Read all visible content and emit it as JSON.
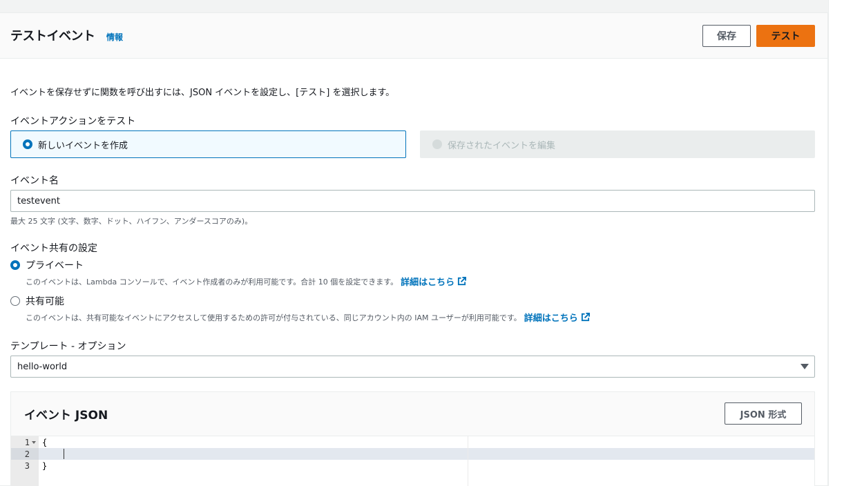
{
  "header": {
    "title": "テストイベント",
    "info": "情報",
    "save_label": "保存",
    "test_label": "テスト"
  },
  "description": "イベントを保存せずに関数を呼び出すには、JSON イベントを設定し、[テスト] を選択します。",
  "event_action": {
    "label": "イベントアクションをテスト",
    "options": [
      {
        "label": "新しいイベントを作成",
        "selected": true
      },
      {
        "label": "保存されたイベントを編集",
        "selected": false,
        "disabled": true
      }
    ]
  },
  "event_name": {
    "label": "イベント名",
    "value": "testevent",
    "hint": "最大 25 文字 (文字、数字、ドット、ハイフン、アンダースコアのみ)。"
  },
  "sharing": {
    "label": "イベント共有の設定",
    "private_label": "プライベート",
    "private_desc": "このイベントは、Lambda コンソールで、イベント作成者のみが利用可能です。合計 10 個を設定できます。",
    "shareable_label": "共有可能",
    "shareable_desc": "このイベントは、共有可能なイベントにアクセスして使用するための許可が付与されている、同じアカウント内の IAM ユーザーが利用可能です。",
    "more_link": "詳細はこちら",
    "selected": "private"
  },
  "template": {
    "label": "テンプレート - オプション",
    "value": "hello-world"
  },
  "json_editor": {
    "title": "イベント JSON",
    "format_label": "JSON 形式",
    "lines": [
      {
        "n": "1",
        "code": "{"
      },
      {
        "n": "2",
        "code": ""
      },
      {
        "n": "3",
        "code": "}"
      }
    ]
  },
  "colors": {
    "accent": "#0073bb",
    "primary_button": "#ec7211"
  }
}
